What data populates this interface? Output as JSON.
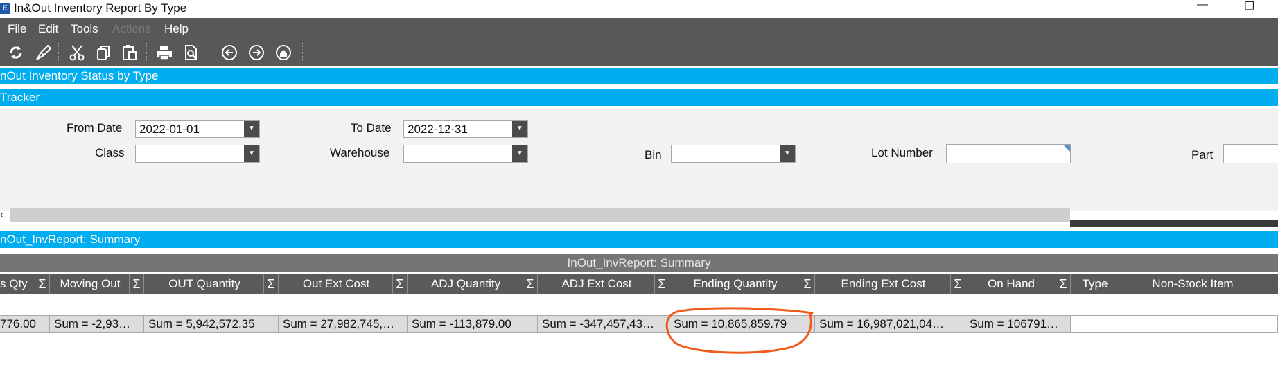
{
  "window": {
    "title": "In&Out Inventory Report By Type",
    "minimize_glyph": "—",
    "restore_glyph": "❐"
  },
  "menu": {
    "file": "File",
    "edit": "Edit",
    "tools": "Tools",
    "actions": "Actions",
    "help": "Help"
  },
  "toolbar_icons": [
    "refresh-icon",
    "clear-icon",
    "cut-icon",
    "copy-icon",
    "paste-icon",
    "print-icon",
    "print-preview-icon",
    "back-icon",
    "forward-icon",
    "home-icon"
  ],
  "panels": {
    "status_header": "nOut Inventory Status by Type",
    "tracker_header": "Tracker",
    "summary_header": "nOut_InvReport: Summary"
  },
  "form": {
    "from_date_label": "From Date",
    "from_date_value": "2022-01-01",
    "to_date_label": "To Date",
    "to_date_value": "2022-12-31",
    "class_label": "Class",
    "class_value": "",
    "warehouse_label": "Warehouse",
    "warehouse_value": "",
    "bin_label": "Bin",
    "bin_value": "",
    "lot_number_label": "Lot Number",
    "lot_number_value": "",
    "part_label": "Part",
    "part_value": ""
  },
  "grid": {
    "caption": "InOut_InvReport: Summary",
    "sigma": "Σ",
    "columns": [
      "s Qty",
      "Moving Out",
      "OUT Quantity",
      "Out Ext Cost",
      "ADJ Quantity",
      "ADJ Ext Cost",
      "Ending Quantity",
      "Ending Ext Cost",
      "On Hand",
      "Type",
      "Non-Stock Item"
    ],
    "sums": [
      "776.00",
      "Sum = -2,93…",
      "Sum = 5,942,572.35",
      "Sum = 27,982,745,…",
      "Sum = -113,879.00",
      "Sum = -347,457,43…",
      "Sum = 10,865,859.79",
      "Sum = 16,987,021,04…",
      "Sum = 106791…"
    ]
  },
  "colors": {
    "accent_blue": "#00adef",
    "menu_bg": "#5a5856",
    "annotation": "#f05a1c"
  }
}
